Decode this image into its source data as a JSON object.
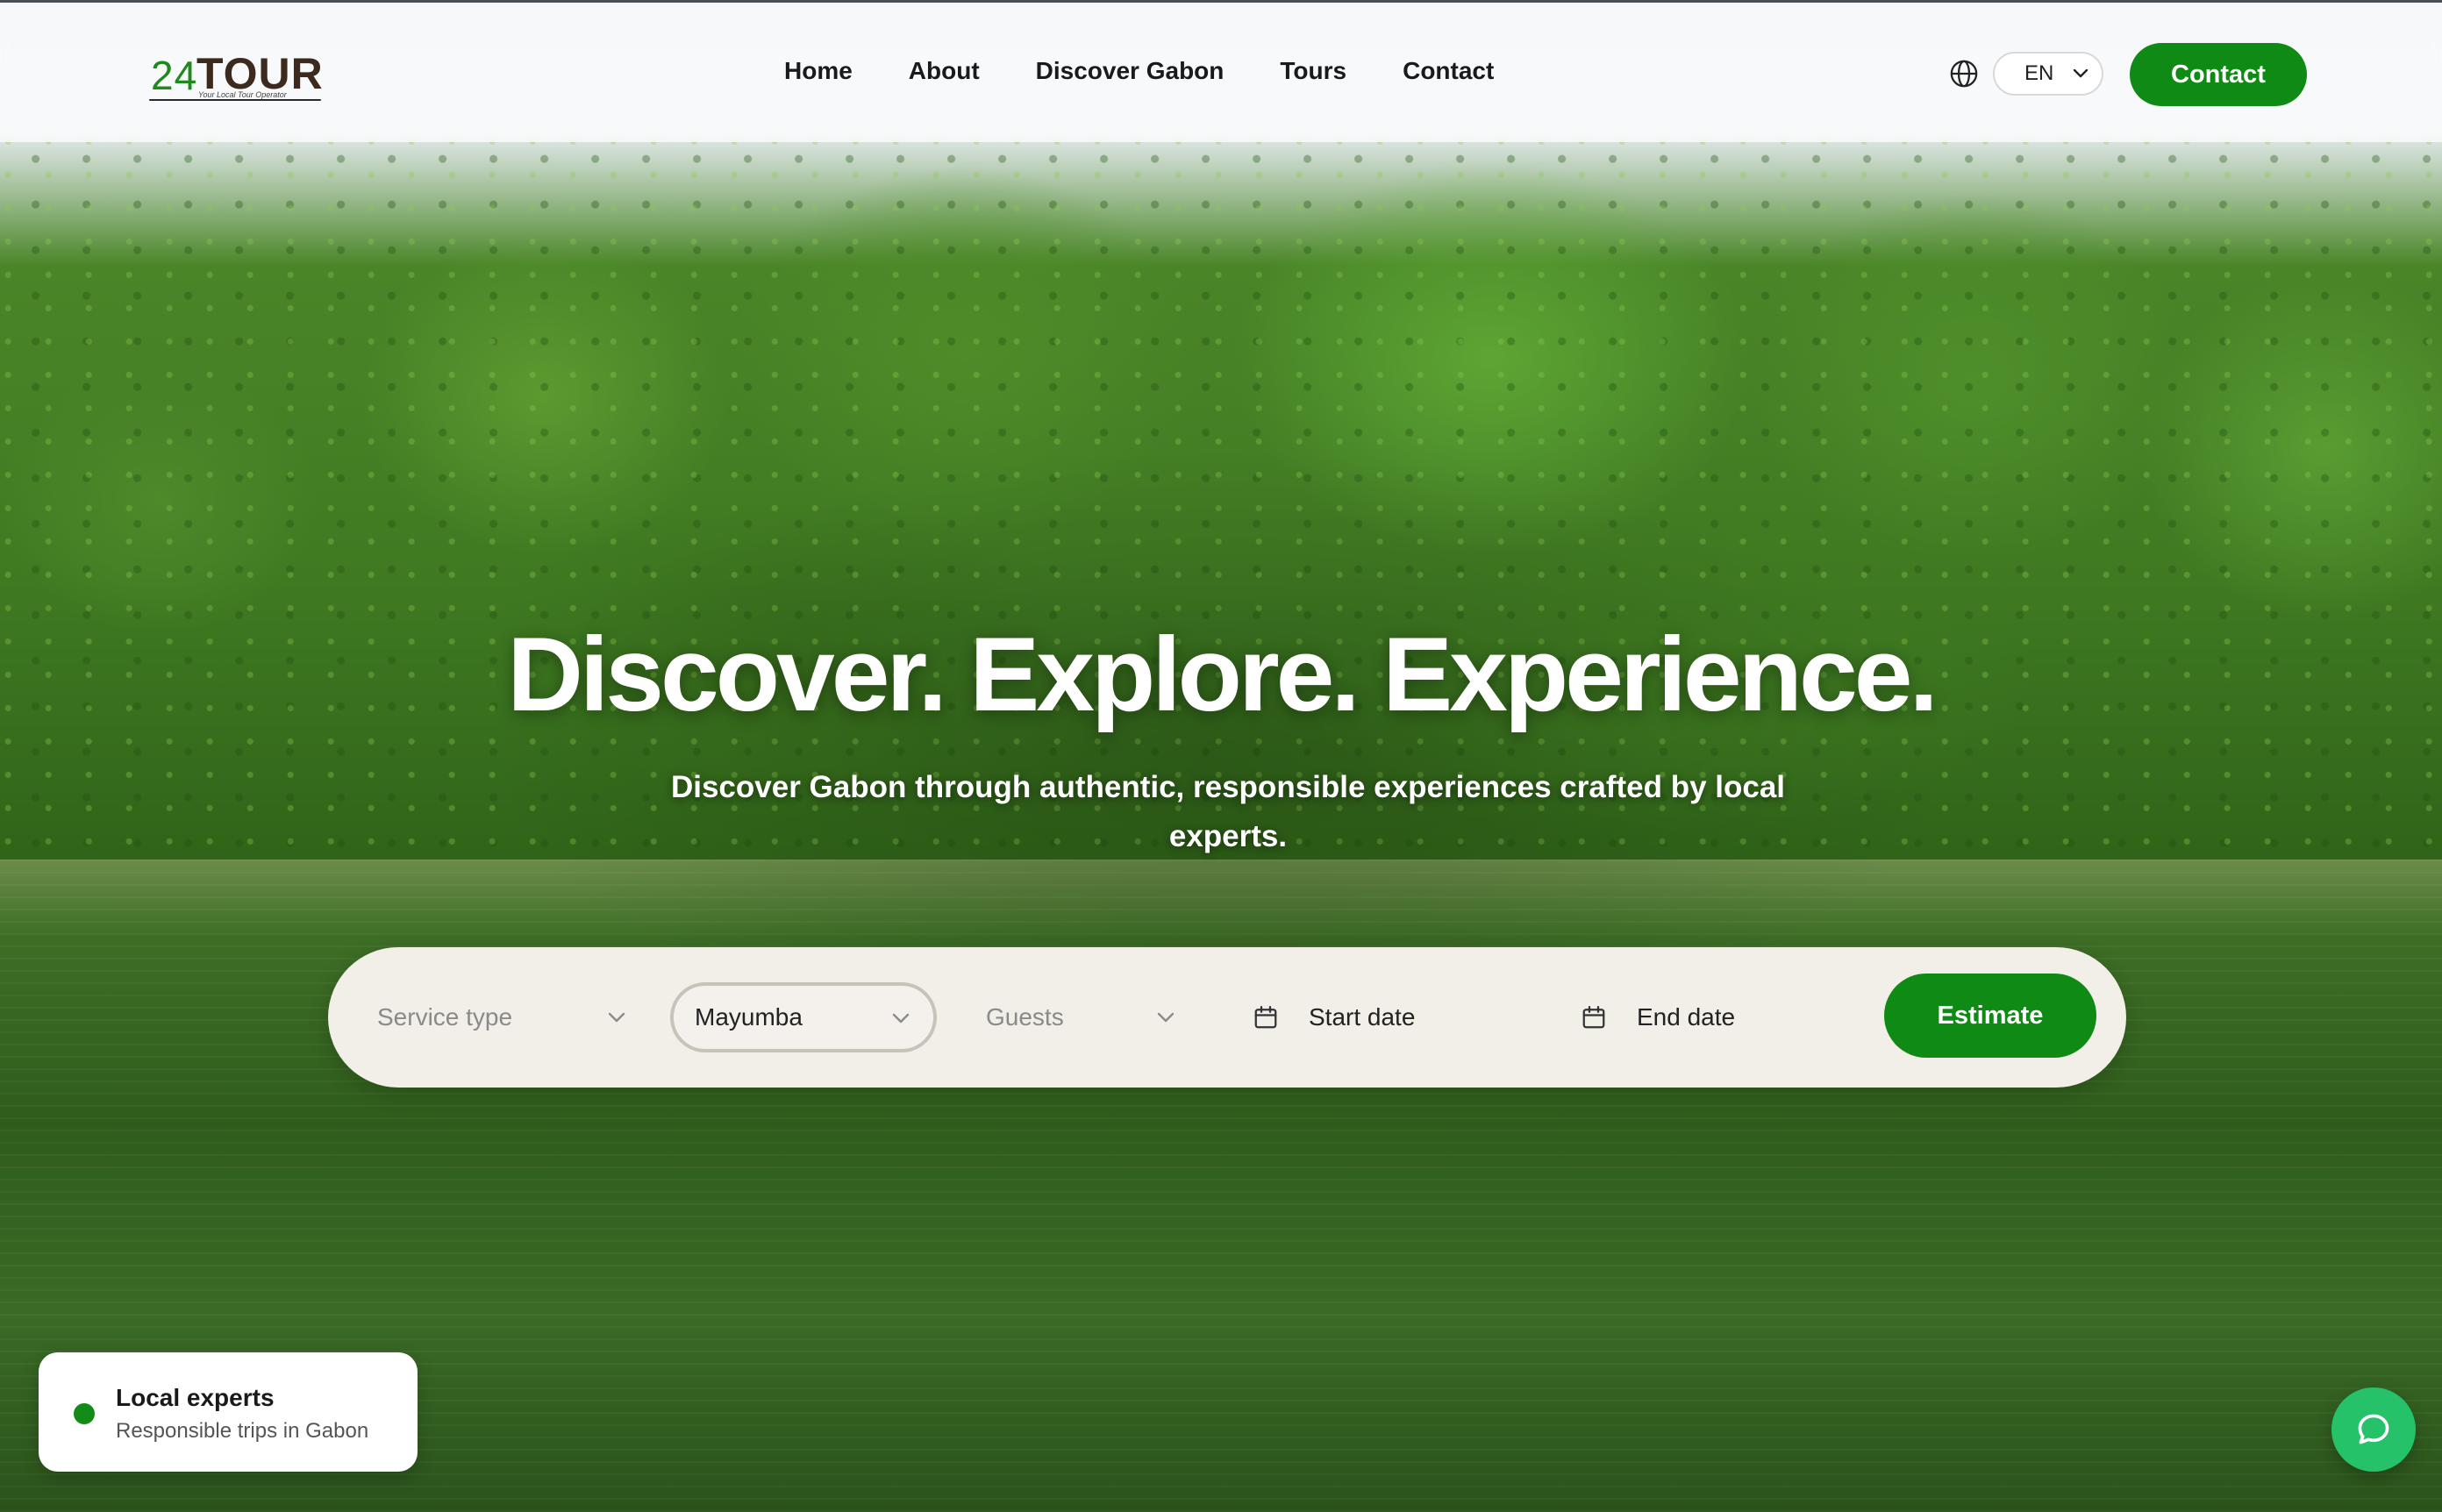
{
  "brand": {
    "logo_number": "24",
    "logo_word": "TOUR",
    "logo_tagline": "Your Local Tour Operator"
  },
  "nav": {
    "items": [
      "Home",
      "About",
      "Discover Gabon",
      "Tours",
      "Contact"
    ]
  },
  "header": {
    "language": "EN",
    "contact_label": "Contact"
  },
  "hero": {
    "headline": "Discover. Explore. Experience.",
    "subline": "Discover Gabon through authentic, responsible experiences crafted by local experts."
  },
  "search": {
    "service_placeholder": "Service type",
    "location_value": "Mayumba",
    "guests_placeholder": "Guests",
    "start_date_placeholder": "Start date",
    "end_date_placeholder": "End date",
    "estimate_label": "Estimate"
  },
  "badge": {
    "title": "Local experts",
    "subtitle": "Responsible trips in Gabon"
  },
  "icons": {
    "globe": "globe-icon",
    "chevron": "chevron-down-icon",
    "calendar": "calendar-icon",
    "chat": "chat-bubble-icon"
  },
  "colors": {
    "accent": "#0f8a14",
    "chat": "#25c26a",
    "search_bg": "#f2eee8"
  }
}
